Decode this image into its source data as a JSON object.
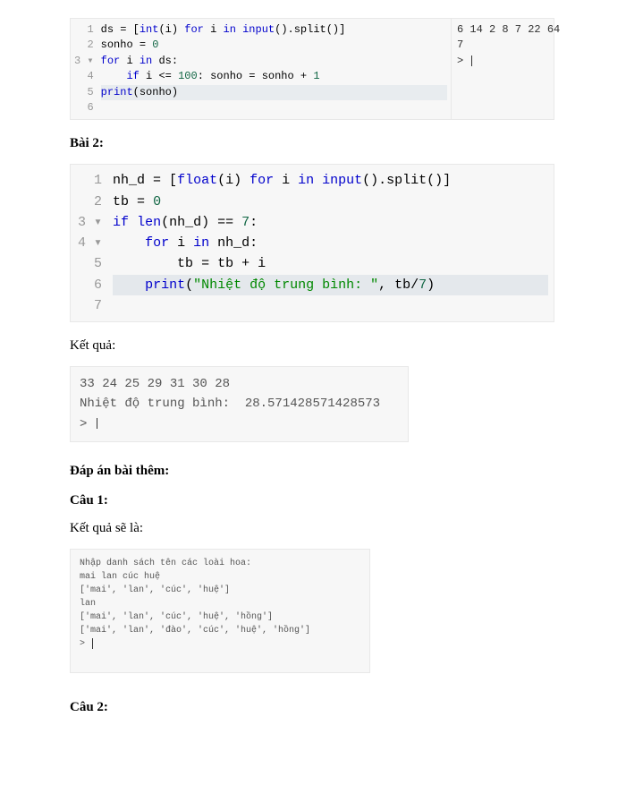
{
  "block1": {
    "lines": [
      {
        "n": "1",
        "html": "ds = [<span class='kw'>int</span>(i) <span class='kw'>for</span> i <span class='kw'>in</span> <span class='kw'>input</span>().split()]"
      },
      {
        "n": "2",
        "html": "sonho = <span class='num'>0</span>"
      },
      {
        "n": "3",
        "fold": true,
        "html": "<span class='kw'>for</span> i <span class='kw'>in</span> ds:"
      },
      {
        "n": "4",
        "html": "    <span class='kw'>if</span> i &lt;= <span class='num'>100</span>: sonho = sonho + <span class='num'>1</span>"
      },
      {
        "n": "5",
        "hl": true,
        "html": "<span class='kw'>print</span>(sonho)"
      },
      {
        "n": "6",
        "html": ""
      }
    ],
    "output": "6 14 2 8 7 22 64\n7\n> "
  },
  "heading_bai2": "Bài 2:",
  "block2": {
    "lines": [
      {
        "n": "1",
        "html": "nh_d = [<span class='kw'>float</span>(i) <span class='kw'>for</span> i <span class='kw'>in</span> <span class='kw'>input</span>().split()]"
      },
      {
        "n": "2",
        "html": "tb = <span class='num'>0</span>"
      },
      {
        "n": "3",
        "fold": true,
        "html": "<span class='kw'>if</span> <span class='kw'>len</span>(nh_d) == <span class='num'>7</span>:"
      },
      {
        "n": "4",
        "fold": true,
        "html": "    <span class='kw'>for</span> i <span class='kw'>in</span> nh_d:"
      },
      {
        "n": "5",
        "html": "        tb = tb + i"
      },
      {
        "n": "6",
        "hl": true,
        "html": "    <span class='kw'>print</span>(<span class='str'>\"Nhiệt độ trung bình: \"</span>, tb/<span class='num'>7</span>)"
      },
      {
        "n": "7",
        "html": ""
      }
    ]
  },
  "ketqua_label": "Kết quả:",
  "output1": "33 24 25 29 31 30 28\nNhiệt độ trung bình:  28.571428571428573\n> ",
  "heading_dapan": "Đáp án bài thêm:",
  "heading_cau1": "Câu 1:",
  "ketqua_se_la": "Kết quả sẽ là:",
  "output2": "Nhập danh sách tên các loài hoa:\nmai lan cúc huệ\n['mai', 'lan', 'cúc', 'huệ']\nlan\n['mai', 'lan', 'cúc', 'huệ', 'hồng']\n['mai', 'lan', 'đào', 'cúc', 'huệ', 'hồng']\n> ",
  "heading_cau2": "Câu 2:"
}
